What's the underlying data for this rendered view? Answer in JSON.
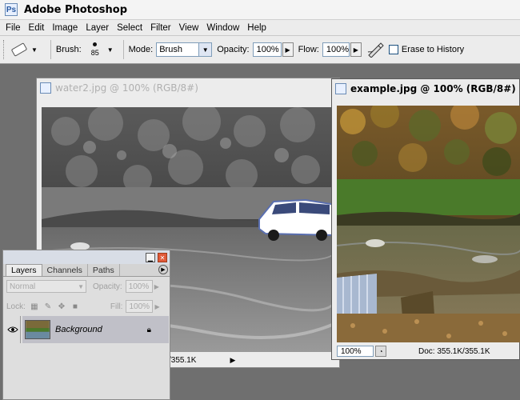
{
  "app": {
    "title": "Adobe Photoshop"
  },
  "menu": [
    "File",
    "Edit",
    "Image",
    "Layer",
    "Select",
    "Filter",
    "View",
    "Window",
    "Help"
  ],
  "options": {
    "tool_icon": "eraser-icon",
    "brush_label": "Brush:",
    "brush_size": "85",
    "mode_label": "Mode:",
    "mode_value": "Brush",
    "opacity_label": "Opacity:",
    "opacity_value": "100%",
    "flow_label": "Flow:",
    "flow_value": "100%",
    "erase_history_label": "Erase to History",
    "erase_history_checked": false
  },
  "documents": {
    "water": {
      "title": "water2.jpg @ 100% (RGB/8#)",
      "status": "/355.1K"
    },
    "example": {
      "title": "example.jpg @ 100% (RGB/8#)",
      "zoom": "100%",
      "status": "Doc: 355.1K/355.1K"
    }
  },
  "layers_panel": {
    "tabs": [
      "Layers",
      "Channels",
      "Paths"
    ],
    "active_tab": "Layers",
    "blend_mode": "Normal",
    "opacity_label": "Opacity:",
    "opacity_value": "100%",
    "lock_label": "Lock:",
    "fill_label": "Fill:",
    "fill_value": "100%",
    "layers": [
      {
        "name": "Background",
        "visible": true,
        "locked": true
      }
    ]
  },
  "colors": {
    "workspace": "#6f6f6f",
    "ui_gray": "#ececec",
    "layer_selected": "#c0c0c8"
  }
}
